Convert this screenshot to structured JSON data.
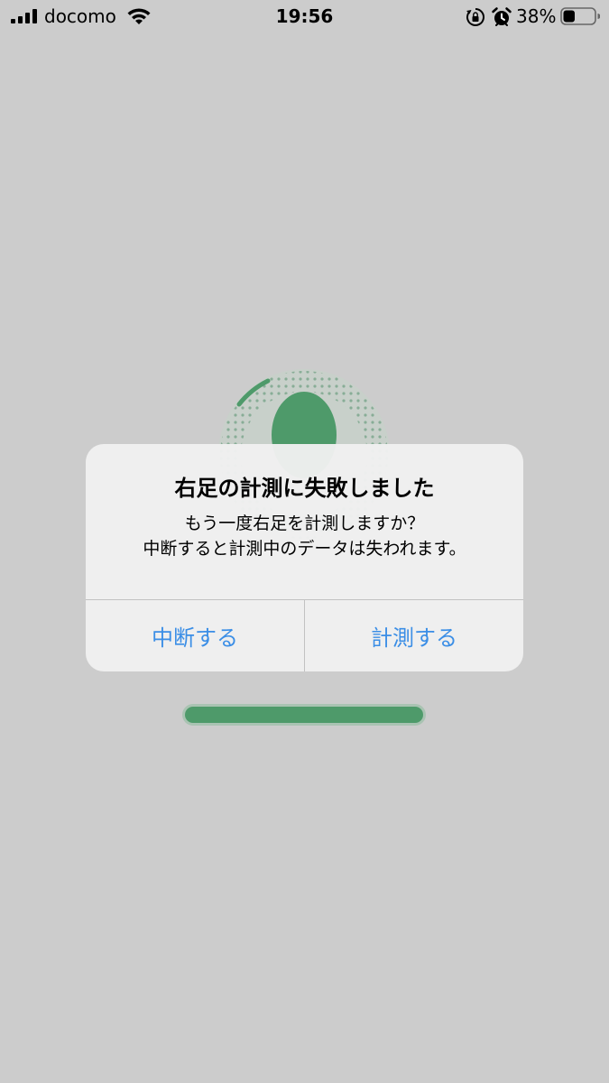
{
  "status_bar": {
    "carrier": "docomo",
    "time": "19:56",
    "battery_percent": "38%",
    "battery_level": 0.38,
    "icons": [
      "signal-icon",
      "wifi-icon",
      "orientation-lock-icon",
      "alarm-icon",
      "battery-icon"
    ]
  },
  "background": {
    "accent_color": "#4e9a6a",
    "progress_value": 1.0
  },
  "alert": {
    "title": "右足の計測に失敗しました",
    "message_line1": "もう一度右足を計測しますか？",
    "message_line2": "中断すると計測中のデータは失われます。",
    "cancel_label": "中断する",
    "confirm_label": "計測する",
    "button_color": "#3b8ee6"
  }
}
